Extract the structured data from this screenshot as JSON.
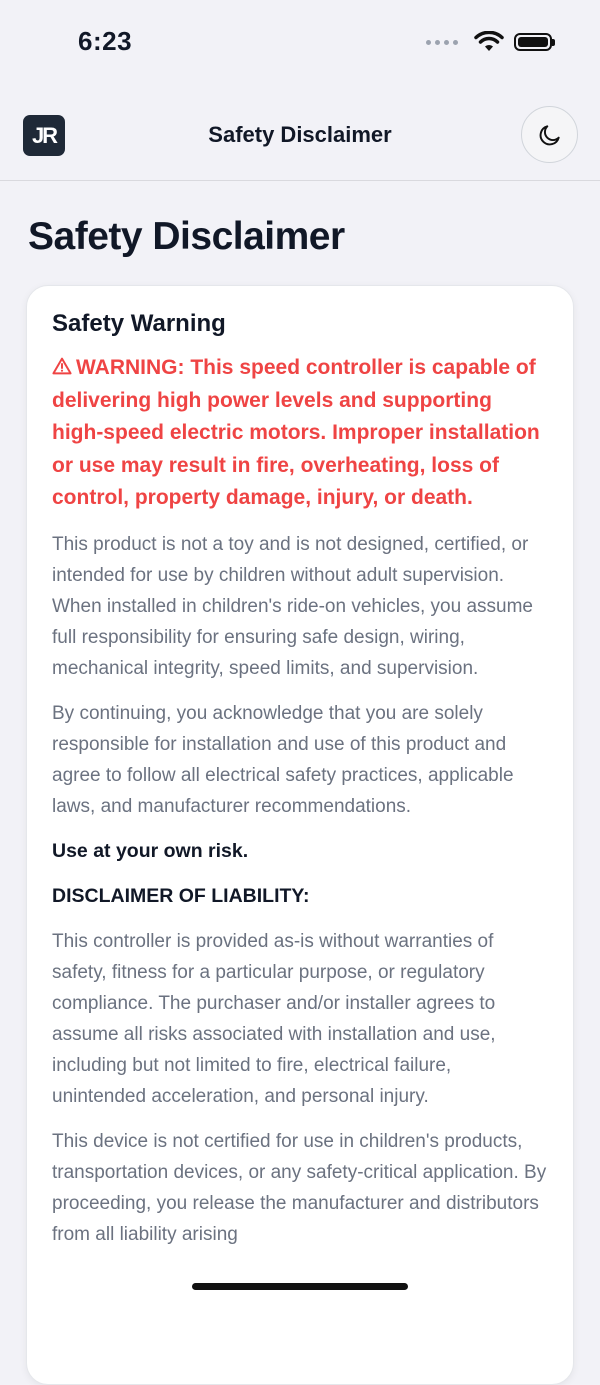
{
  "status_bar": {
    "time": "6:23"
  },
  "nav": {
    "logo_text": "JR",
    "title": "Safety Disclaimer",
    "theme_icon": "moon-icon"
  },
  "page": {
    "title": "Safety Disclaimer"
  },
  "card": {
    "heading": "Safety Warning",
    "warning_icon": "warning-triangle-icon",
    "warning_text": "WARNING: This speed controller is capable of delivering high power levels and supporting high-speed electric motors. Improper installation or use may result in fire, overheating, loss of control, property damage, injury, or death.",
    "paragraph1": "This product is not a toy and is not designed, certified, or intended for use by children without adult supervision. When installed in children's ride-on vehicles, you assume full responsibility for ensuring safe design, wiring, mechanical integrity, speed limits, and supervision.",
    "paragraph2": "By continuing, you acknowledge that you are solely responsible for installation and use of this product and agree to follow all electrical safety practices, applicable laws, and manufacturer recommendations.",
    "risk_line": "Use at your own risk.",
    "liability_heading": "DISCLAIMER OF LIABILITY:",
    "paragraph3": "This controller is provided as-is without warranties of safety, fitness for a particular purpose, or regulatory compliance. The purchaser and/or installer agrees to assume all risks associated with installation and use, including but not limited to fire, electrical failure, unintended acceleration, and personal injury.",
    "paragraph4": "This device is not certified for use in children's products, transportation devices, or any safety-critical application. By proceeding, you release the manufacturer and distributors from all liability arising"
  },
  "colors": {
    "warning": "#ef4444",
    "logo_bg": "#1f2937",
    "body_text": "#6b7280",
    "heading_text": "#111827"
  }
}
